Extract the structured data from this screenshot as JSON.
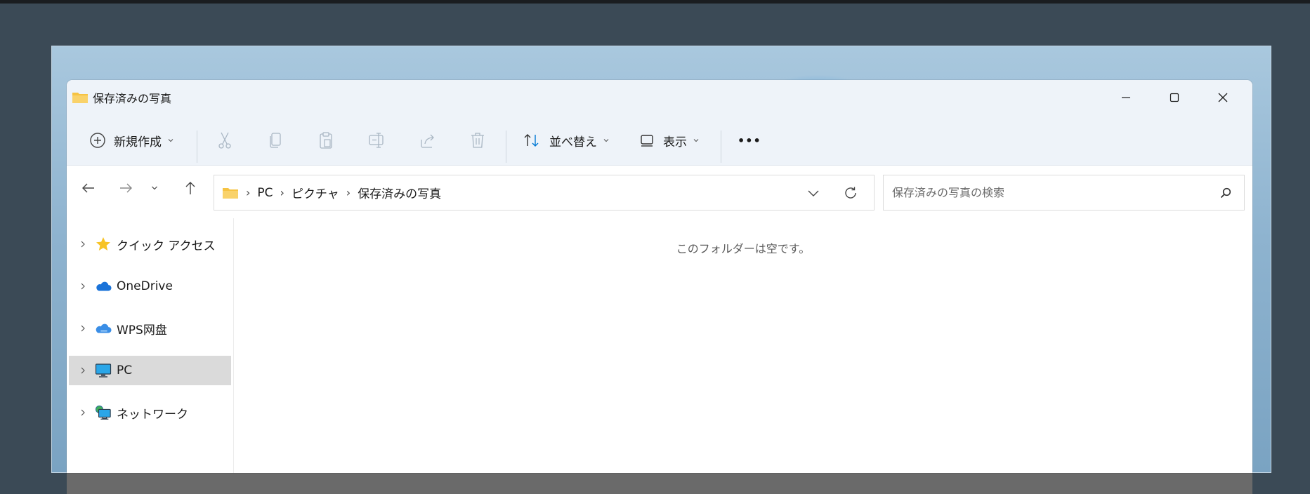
{
  "window": {
    "title": "保存済みの写真"
  },
  "toolbar": {
    "new_label": "新規作成",
    "sort_label": "並べ替え",
    "view_label": "表示",
    "more_label": "•••"
  },
  "address": {
    "crumbs": [
      "PC",
      "ピクチャ",
      "保存済みの写真"
    ]
  },
  "search": {
    "placeholder": "保存済みの写真の検索"
  },
  "sidebar": {
    "items": [
      {
        "label": "クイック アクセス",
        "icon": "star-icon"
      },
      {
        "label": "OneDrive",
        "icon": "cloud-icon"
      },
      {
        "label": "WPS网盘",
        "icon": "wps-cloud-icon"
      },
      {
        "label": "PC",
        "icon": "monitor-icon",
        "selected": true
      },
      {
        "label": "ネットワーク",
        "icon": "network-icon"
      }
    ]
  },
  "content": {
    "empty_message": "このフォルダーは空です。"
  },
  "colors": {
    "accent": "#0078d4",
    "folder": "#f6c343",
    "selected_bg": "#dadada"
  }
}
